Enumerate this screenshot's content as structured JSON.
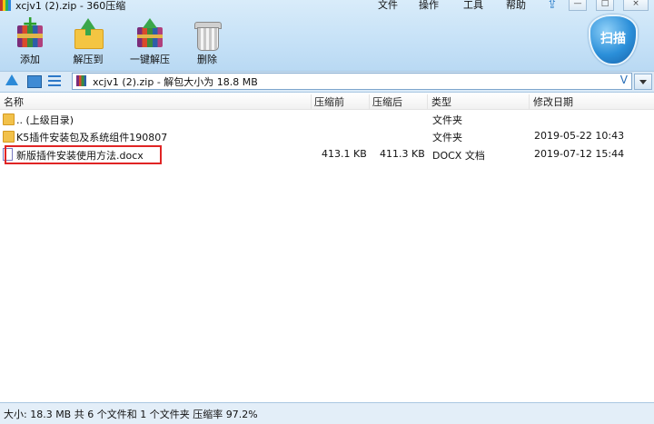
{
  "window": {
    "title": "xcjv1 (2).zip - 360压缩",
    "menus": [
      "文件",
      "操作",
      "工具",
      "帮助"
    ],
    "controls": {
      "minimize": "—",
      "maximize": "□",
      "close": "×"
    }
  },
  "toolbar": {
    "add": "添加",
    "extract_to": "解压到",
    "one_click_extract": "一键解压",
    "delete": "删除",
    "scan": "扫描"
  },
  "address": {
    "path": "xcjv1 (2).zip - 解包大小为 18.8 MB",
    "dropdown_symbol": "V"
  },
  "columns": {
    "name": "名称",
    "before": "压缩前",
    "after": "压缩后",
    "type": "类型",
    "date": "修改日期"
  },
  "rows": [
    {
      "name": ".. (上级目录)",
      "before": "",
      "after": "",
      "type": "文件夹",
      "date": "",
      "icon": "folder-icon"
    },
    {
      "name": "K5插件安装包及系统组件190807",
      "before": "",
      "after": "",
      "type": "文件夹",
      "date": "2019-05-22 10:43",
      "icon": "folder-icon"
    },
    {
      "name": "新版插件安装使用方法.docx",
      "before": "413.1 KB",
      "after": "411.3 KB",
      "type": "DOCX 文档",
      "date": "2019-07-12 15:44",
      "icon": "docx-icon"
    }
  ],
  "status": {
    "text": "大小: 18.3 MB 共 6 个文件和 1 个文件夹 压缩率 97.2%"
  },
  "colors": {
    "accent": "#2c8ad8",
    "highlight_box": "#e02424",
    "toolbar_bg": "#c7e2f7"
  }
}
